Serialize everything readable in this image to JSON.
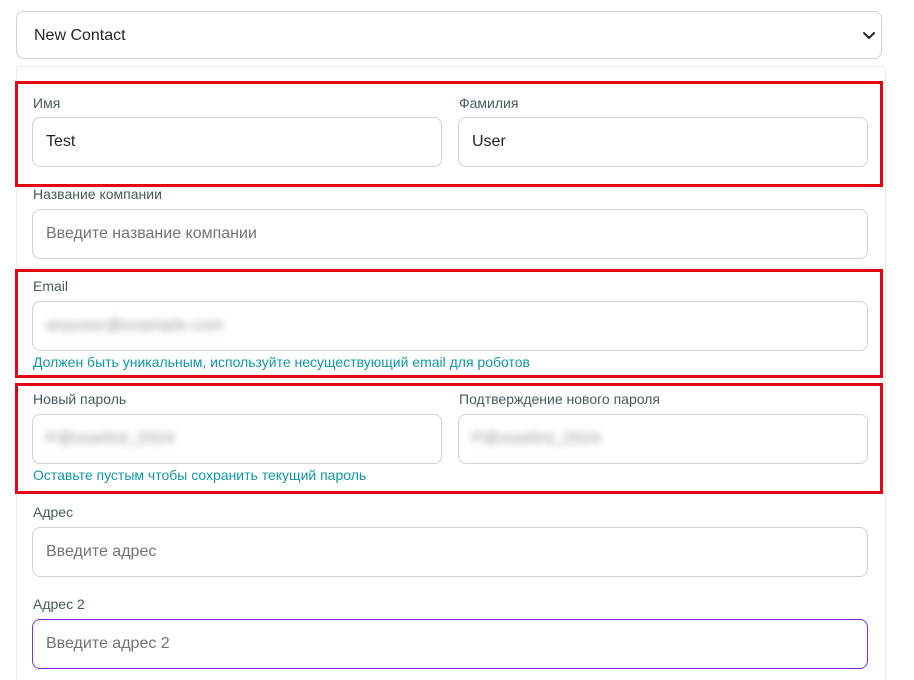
{
  "contact_type": {
    "selected": "New Contact"
  },
  "form": {
    "first_name": {
      "label": "Имя",
      "value": "Test"
    },
    "last_name": {
      "label": "Фамилия",
      "value": "User"
    },
    "company": {
      "label": "Название компании",
      "placeholder": "Введите название компании"
    },
    "email": {
      "label": "Email",
      "value": "anyuser@example.com",
      "help": "Должен быть уникальным, используйте несуществующий email для роботов"
    },
    "new_password": {
      "label": "Новый пароль",
      "value": "P@ssw0rd_2024"
    },
    "confirm_password": {
      "label": "Подтверждение нового пароля",
      "value": "P@ssw0rd_2024"
    },
    "password_help": "Оставьте пустым чтобы сохранить текущий пароль",
    "address": {
      "label": "Адрес",
      "placeholder": "Введите адрес"
    },
    "address2": {
      "label": "Адрес 2",
      "placeholder": "Введите адрес 2"
    }
  },
  "colors": {
    "highlight": "#e30613",
    "help_text": "#0f97a8",
    "focus_border": "#8a2be2"
  }
}
